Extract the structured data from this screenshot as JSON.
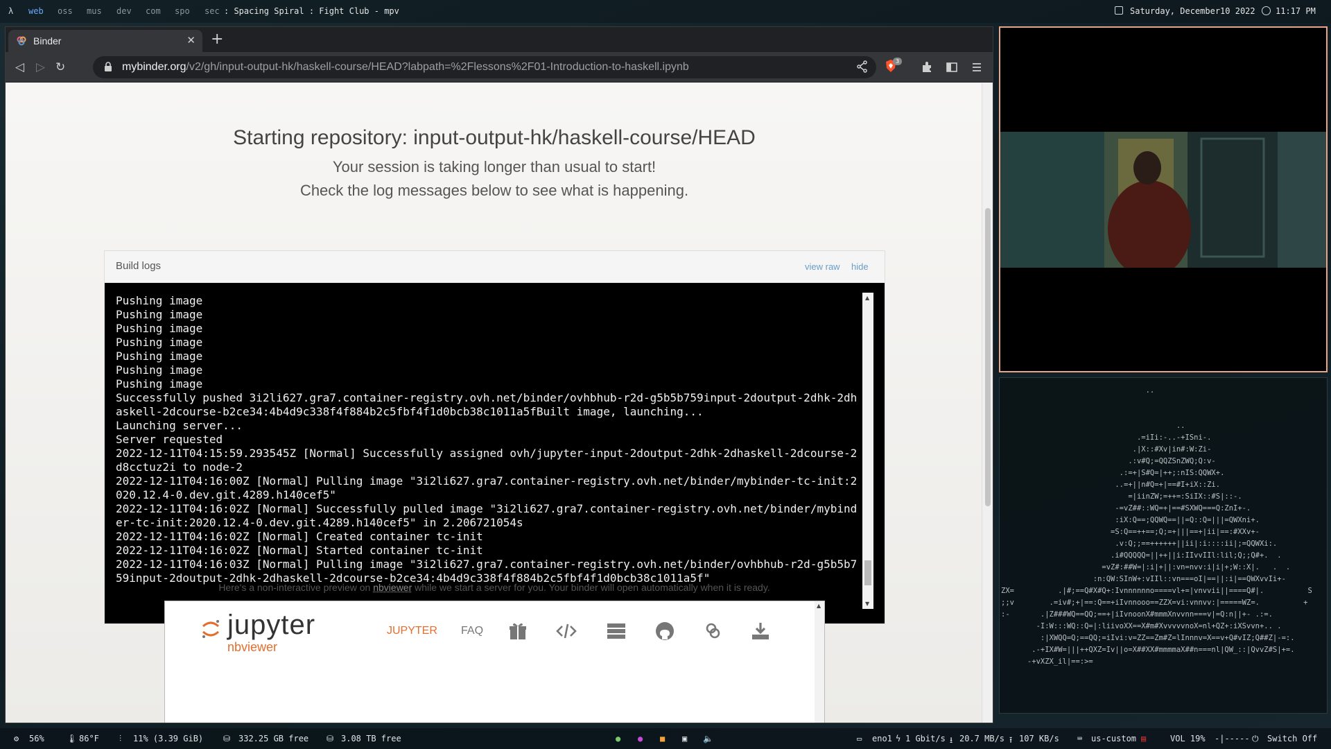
{
  "topbar": {
    "lambda": "λ",
    "workspaces": [
      "web",
      "oss",
      "mus",
      "dev",
      "com",
      "spo",
      "sec"
    ],
    "active_workspace": "web",
    "window_title": ": Spacing Spiral :  Fight Club - mpv",
    "date": "Saturday, December10 2022",
    "time": "11:17 PM"
  },
  "browser": {
    "tab_title": "Binder",
    "tab_close": "✕",
    "new_tab": "+",
    "url_host": "mybinder.org",
    "url_path": "/v2/gh/input-output-hk/haskell-course/HEAD?labpath=%2Flessons%2F01-Introduction-to-haskell.ipynb",
    "shields_badge": "3"
  },
  "page": {
    "heading": "Starting repository: input-output-hk/haskell-course/HEAD",
    "subtitle_1": "Your session is taking longer than usual to start!",
    "subtitle_2": "Check the log messages below to see what is happening.",
    "build_logs": {
      "title": "Build logs",
      "view_raw": "view raw",
      "hide": "hide",
      "lines": [
        "Pushing image",
        "Pushing image",
        "Pushing image",
        "Pushing image",
        "Pushing image",
        "Pushing image",
        "Pushing image",
        "Successfully pushed 3i2li627.gra7.container-registry.ovh.net/binder/ovhbhub-r2d-g5b5b759input-2doutput-2dhk-2dhaskell-2dcourse-b2ce34:4b4d9c338f4f884b2c5fbf4f1d0bcb38c1011a5fBuilt image, launching...",
        "Launching server...",
        "Server requested",
        "2022-12-11T04:15:59.293545Z [Normal] Successfully assigned ovh/jupyter-input-2doutput-2dhk-2dhaskell-2dcourse-2d8cctuz2i to node-2",
        "2022-12-11T04:16:00Z [Normal] Pulling image \"3i2li627.gra7.container-registry.ovh.net/binder/mybinder-tc-init:2020.12.4-0.dev.git.4289.h140cef5\"",
        "2022-12-11T04:16:02Z [Normal] Successfully pulled image \"3i2li627.gra7.container-registry.ovh.net/binder/mybinder-tc-init:2020.12.4-0.dev.git.4289.h140cef5\" in 2.206721054s",
        "2022-12-11T04:16:02Z [Normal] Created container tc-init",
        "2022-12-11T04:16:02Z [Normal] Started container tc-init",
        "2022-12-11T04:16:03Z [Normal] Pulling image \"3i2li627.gra7.container-registry.ovh.net/binder/ovhbhub-r2d-g5b5b759input-2doutput-2dhk-2dhaskell-2dcourse-b2ce34:4b4d9c338f4f884b2c5fbf4f1d0bcb38c1011a5f\""
      ]
    },
    "preview_before": "Here's a non-interactive preview on ",
    "preview_link": "nbviewer",
    "preview_after": " while we start a server for you. Your binder will open automatically when it is ready.",
    "nbviewer": {
      "logo": "jupyter",
      "logo_sub": "nbviewer",
      "nav": [
        "JUPYTER",
        "FAQ"
      ],
      "nav_active_color": "#e46e2e"
    }
  },
  "statusbar": {
    "cpu": "56%",
    "temp": "86°F",
    "mem": "11% (3.39 GiB)",
    "disk1": "332.25 GB free",
    "disk2": "3.08 TB free",
    "net_iface": "eno1",
    "net_speed": "1 Gbit/s",
    "down": "20.7 MB/s",
    "up": "107 KB/s",
    "keyboard": "us-custom",
    "volume": "VOL 19%",
    "power": "Switch Off"
  },
  "colors": {
    "accent": "#6aa9ff",
    "jupyter_orange": "#e46e2e",
    "mpv_border": "#e9a58a"
  }
}
